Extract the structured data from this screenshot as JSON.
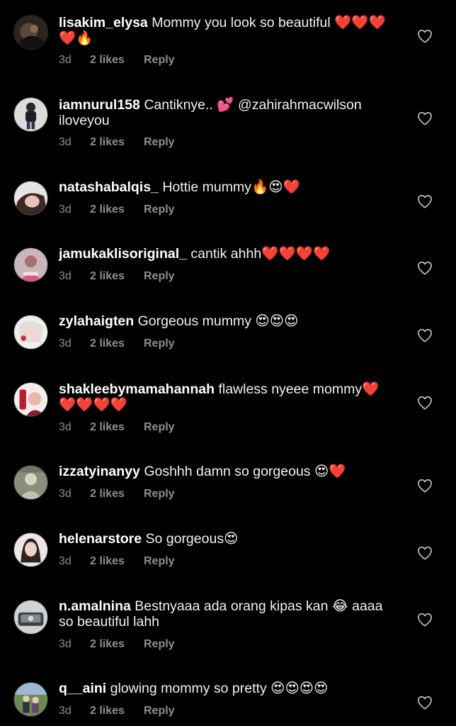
{
  "comments": [
    {
      "username": "lisakim_elysa",
      "text": "Mommy you look so beautiful ❤️❤️❤️❤️🔥",
      "time": "3d",
      "likes": "2 likes",
      "reply": "Reply"
    },
    {
      "username": "iamnurul158",
      "text": "Cantiknye.. 💕 @zahirahmacwilson iloveyou",
      "time": "3d",
      "likes": "2 likes",
      "reply": "Reply"
    },
    {
      "username": "natashabalqis_",
      "text": "Hottie mummy🔥😍❤️",
      "time": "3d",
      "likes": "2 likes",
      "reply": "Reply"
    },
    {
      "username": "jamukaklisoriginal_",
      "text": "cantik ahhh❤️❤️❤️❤️",
      "time": "3d",
      "likes": "2 likes",
      "reply": "Reply"
    },
    {
      "username": "zylahaigten",
      "text": "Gorgeous mummy 😍😍😍",
      "time": "3d",
      "likes": "2 likes",
      "reply": "Reply"
    },
    {
      "username": "shakleebymamahannah",
      "text": "flawless nyeee mommy❤️❤️❤️❤️❤️",
      "time": "3d",
      "likes": "2 likes",
      "reply": "Reply"
    },
    {
      "username": "izzatyinanyy",
      "text": "Goshhh damn so gorgeous 😍❤️",
      "time": "3d",
      "likes": "2 likes",
      "reply": "Reply"
    },
    {
      "username": "helenarstore",
      "text": "So gorgeous😍",
      "time": "3d",
      "likes": "2 likes",
      "reply": "Reply"
    },
    {
      "username": "n.amalnina",
      "text": "Bestnyaaa ada orang kipas kan 😂 aaaa so beautiful lahh",
      "time": "3d",
      "likes": "2 likes",
      "reply": "Reply"
    },
    {
      "username": "q__aini",
      "text": "glowing mommy so pretty 😍😍😍😍",
      "time": "3d",
      "likes": "2 likes",
      "reply": "Reply"
    }
  ],
  "colors": {
    "background": "#000000",
    "text": "#f2f2f2",
    "meta": "#8e8e8e"
  }
}
